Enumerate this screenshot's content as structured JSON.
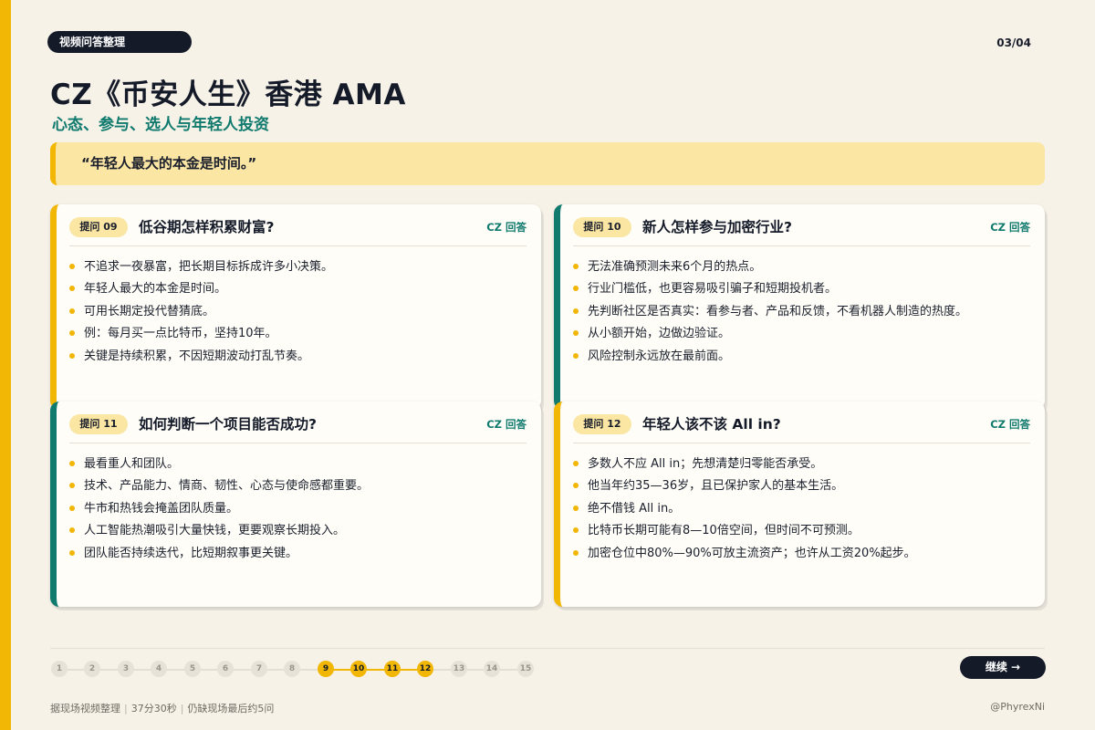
{
  "header": {
    "tag": "视频问答整理",
    "page": "03/04"
  },
  "title": "CZ《币安人生》香港 AMA",
  "subtitle": "心态、参与、选人与年轻人投资",
  "quote": "“年轻人最大的本金是时间。”",
  "cards": [
    {
      "badge": "提问 09",
      "title": "低谷期怎样积累财富?",
      "answer_label": "CZ 回答",
      "items": [
        "不追求一夜暴富，把长期目标拆成许多小决策。",
        "年轻人最大的本金是时间。",
        "可用长期定投代替猜底。",
        "例：每月买一点比特币，坚持10年。",
        "关键是持续积累，不因短期波动打乱节奏。"
      ]
    },
    {
      "badge": "提问 10",
      "title": "新人怎样参与加密行业?",
      "answer_label": "CZ 回答",
      "items": [
        "无法准确预测未来6个月的热点。",
        "行业门槛低，也更容易吸引骗子和短期投机者。",
        "先判断社区是否真实：看参与者、产品和反馈，不看机器人制造的热度。",
        "从小额开始，边做边验证。",
        "风险控制永远放在最前面。"
      ]
    },
    {
      "badge": "提问 11",
      "title": "如何判断一个项目能否成功?",
      "answer_label": "CZ 回答",
      "items": [
        "最看重人和团队。",
        "技术、产品能力、情商、韧性、心态与使命感都重要。",
        "牛市和热钱会掩盖团队质量。",
        "人工智能热潮吸引大量快钱，更要观察长期投入。",
        "团队能否持续迭代，比短期叙事更关键。"
      ]
    },
    {
      "badge": "提问 12",
      "title": "年轻人该不该 All in?",
      "answer_label": "CZ 回答",
      "items": [
        "多数人不应 All in；先想清楚归零能否承受。",
        "他当年约35—36岁，且已保护家人的基本生活。",
        "绝不借钱 All in。",
        "比特币长期可能有8—10倍空间，但时间不可预测。",
        "加密仓位中80%—90%可放主流资产；也许从工资20%起步。"
      ]
    }
  ],
  "progress": {
    "dots": [
      "1",
      "2",
      "3",
      "4",
      "5",
      "6",
      "7",
      "8",
      "9",
      "10",
      "11",
      "12",
      "13",
      "14",
      "15"
    ],
    "active": [
      "9",
      "10",
      "11",
      "12"
    ]
  },
  "continue_label": "继续 →",
  "footer": {
    "source": "据现场视频整理",
    "duration": "37分30秒",
    "note": "仍缺现场最后约5问",
    "handle": "@PhyrexNi"
  },
  "colors": {
    "accent_yellow": "#f2b705",
    "accent_teal": "#107a6e",
    "dark": "#141a28",
    "background": "#f6f2e8",
    "quote_bg": "#fbe6a4"
  }
}
